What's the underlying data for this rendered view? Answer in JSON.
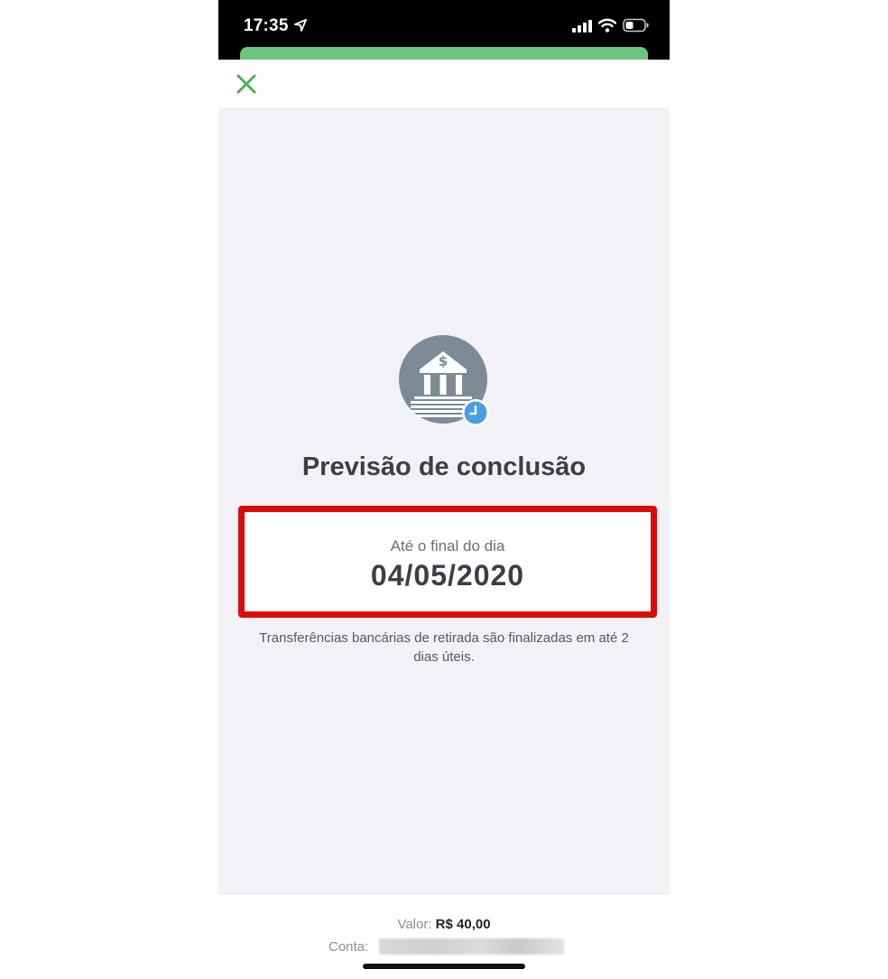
{
  "status_bar": {
    "time": "17:35"
  },
  "header": {
    "close_icon": "close-icon"
  },
  "main": {
    "icon": "bank-clock-icon",
    "title": "Previsão de conclusão",
    "date_caption": "Até o final do dia",
    "date_value": "04/05/2020",
    "info": "Transferências bancárias de retirada são finalizadas em até 2 dias úteis."
  },
  "footer": {
    "valor_label": "Valor:",
    "valor_amount": "R$ 40,00",
    "conta_label": "Conta:"
  },
  "colors": {
    "accent_green": "#4caf50",
    "highlight_red": "#dc0b0b",
    "clock_blue": "#4a9fe0",
    "bank_gray": "#7d8b96"
  }
}
